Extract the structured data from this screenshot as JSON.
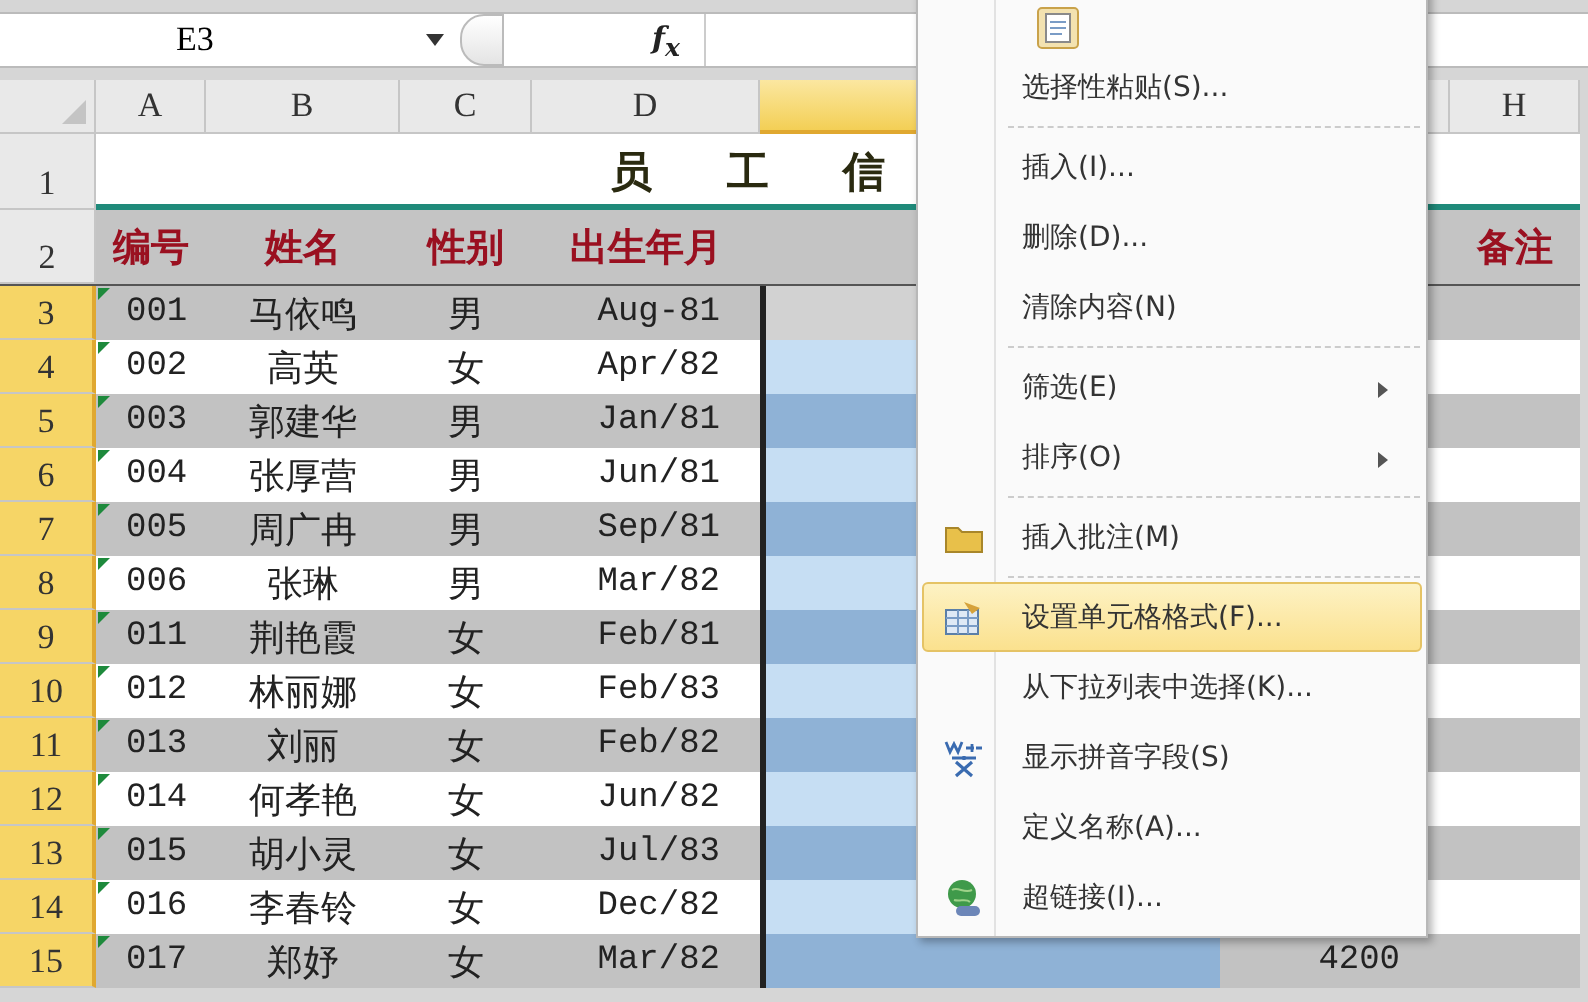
{
  "formula_bar": {
    "name_box": "E3",
    "function_button": "f$_{x}$"
  },
  "columns": [
    {
      "label": "A",
      "selected": false
    },
    {
      "label": "B",
      "selected": false
    },
    {
      "label": "C",
      "selected": false
    },
    {
      "label": "D",
      "selected": false
    },
    {
      "selected": true
    },
    {
      "selected": false
    },
    {
      "label": "H",
      "selected": false
    }
  ],
  "title": "员 工 信",
  "header_row": {
    "number": "2",
    "selected": false,
    "cells": [
      "编号",
      "姓名",
      "性别",
      "出生年月"
    ],
    "note": "备注"
  },
  "title_row": {
    "number": "1",
    "selected": false
  },
  "rows": [
    {
      "number": "3",
      "selected": true,
      "active": true,
      "text_marker": true,
      "cells": [
        "001",
        "马依鸣",
        "男",
        "Aug-81"
      ]
    },
    {
      "number": "4",
      "selected": true,
      "active": false,
      "text_marker": true,
      "cells": [
        "002",
        "高英",
        "女",
        "Apr/82"
      ]
    },
    {
      "number": "5",
      "selected": true,
      "active": false,
      "text_marker": true,
      "cells": [
        "003",
        "郭建华",
        "男",
        "Jan/81"
      ]
    },
    {
      "number": "6",
      "selected": true,
      "active": false,
      "text_marker": true,
      "cells": [
        "004",
        "张厚营",
        "男",
        "Jun/81"
      ]
    },
    {
      "number": "7",
      "selected": true,
      "active": false,
      "text_marker": true,
      "cells": [
        "005",
        "周广冉",
        "男",
        "Sep/81"
      ]
    },
    {
      "number": "8",
      "selected": true,
      "active": false,
      "text_marker": true,
      "cells": [
        "006",
        "张琳",
        "男",
        "Mar/82"
      ]
    },
    {
      "number": "9",
      "selected": true,
      "active": false,
      "text_marker": true,
      "cells": [
        "011",
        "荆艳霞",
        "女",
        "Feb/81"
      ]
    },
    {
      "number": "10",
      "selected": true,
      "active": false,
      "text_marker": true,
      "cells": [
        "012",
        "林丽娜",
        "女",
        "Feb/83"
      ]
    },
    {
      "number": "11",
      "selected": true,
      "active": false,
      "text_marker": true,
      "cells": [
        "013",
        "刘丽",
        "女",
        "Feb/82"
      ]
    },
    {
      "number": "12",
      "selected": true,
      "active": false,
      "text_marker": true,
      "cells": [
        "014",
        "何孝艳",
        "女",
        "Jun/82"
      ]
    },
    {
      "number": "13",
      "selected": true,
      "active": false,
      "text_marker": true,
      "cells": [
        "015",
        "胡小灵",
        "女",
        "Jul/83"
      ]
    },
    {
      "number": "14",
      "selected": true,
      "active": false,
      "text_marker": true,
      "cells": [
        "016",
        "李春铃",
        "女",
        "Dec/82"
      ]
    },
    {
      "number": "15",
      "selected": true,
      "active": false,
      "text_marker": true,
      "cells": [
        "017",
        "郑妤",
        "女",
        "Mar/82"
      ],
      "column_f": "4200"
    }
  ],
  "context_menu": {
    "items": [
      {
        "kind": "paste-options"
      },
      {
        "kind": "plain",
        "label": "选择性粘贴(S)...",
        "submenu": false,
        "highlighted": false,
        "separator_after": true
      },
      {
        "kind": "plain",
        "label": "插入(I)...",
        "submenu": false,
        "highlighted": false,
        "separator_after": false
      },
      {
        "kind": "plain",
        "label": "删除(D)...",
        "submenu": false,
        "highlighted": false,
        "separator_after": false
      },
      {
        "kind": "plain",
        "label": "清除内容(N)",
        "submenu": false,
        "highlighted": false,
        "separator_after": true
      },
      {
        "kind": "plain",
        "label": "筛选(E)",
        "submenu": true,
        "highlighted": false,
        "separator_after": false
      },
      {
        "kind": "plain",
        "label": "排序(O)",
        "submenu": true,
        "highlighted": false,
        "separator_after": true
      },
      {
        "kind": "folder",
        "label": "插入批注(M)",
        "submenu": false,
        "highlighted": false,
        "separator_after": true
      },
      {
        "kind": "format",
        "label": "设置单元格格式(F)...",
        "submenu": false,
        "highlighted": true,
        "separator_after": false
      },
      {
        "kind": "plain",
        "label": "从下拉列表中选择(K)...",
        "submenu": false,
        "highlighted": false,
        "separator_after": false
      },
      {
        "kind": "pinyin",
        "label": "显示拼音字段(S)",
        "submenu": false,
        "highlighted": false,
        "separator_after": false
      },
      {
        "kind": "plain",
        "label": "定义名称(A)...",
        "submenu": false,
        "highlighted": false,
        "separator_after": false
      },
      {
        "kind": "link",
        "label": "超链接(I)...",
        "submenu": false,
        "highlighted": false,
        "separator_after": false
      }
    ]
  }
}
